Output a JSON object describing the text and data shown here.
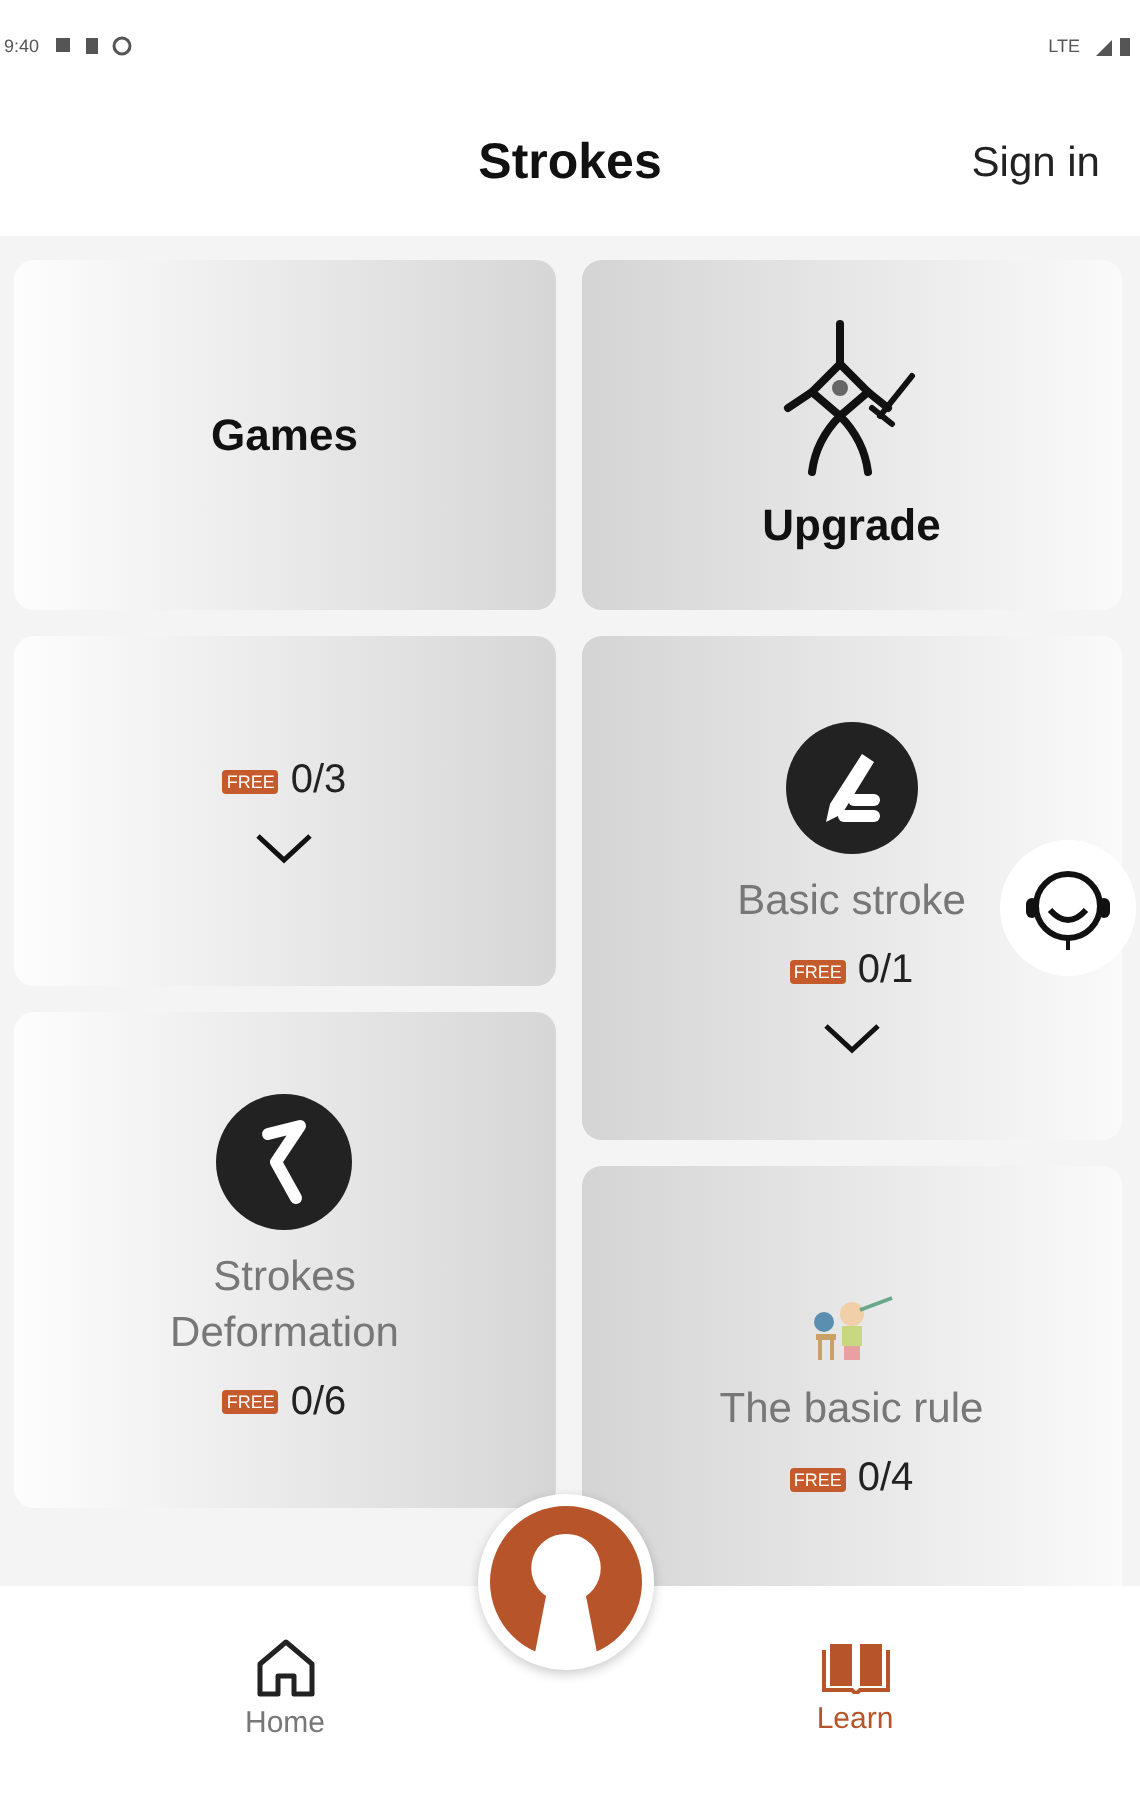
{
  "status_bar": {
    "time": "9:40",
    "network": "LTE"
  },
  "header": {
    "title": "Strokes",
    "action": "Sign in"
  },
  "columns": [
    [
      {
        "kind": "title",
        "title": "Games"
      },
      {
        "kind": "plain",
        "badge": "FREE",
        "progress": "0/3",
        "expandable": true
      },
      {
        "kind": "s-stroke",
        "title": "Strokes Deformation",
        "badge": "FREE",
        "progress": "0/6",
        "expandable": false
      }
    ],
    [
      {
        "kind": "upgrade",
        "title": "Upgrade"
      },
      {
        "kind": "pen",
        "title": "Basic stroke",
        "badge": "FREE",
        "progress": "0/1",
        "expandable": true
      },
      {
        "kind": "picture",
        "title": "The basic rule",
        "badge": "FREE",
        "progress": "0/4",
        "expandable": false
      }
    ]
  ],
  "nav": [
    {
      "label": "Home",
      "kind": "home",
      "selected": false
    },
    {
      "label": "Learn",
      "kind": "book",
      "selected": true
    }
  ]
}
